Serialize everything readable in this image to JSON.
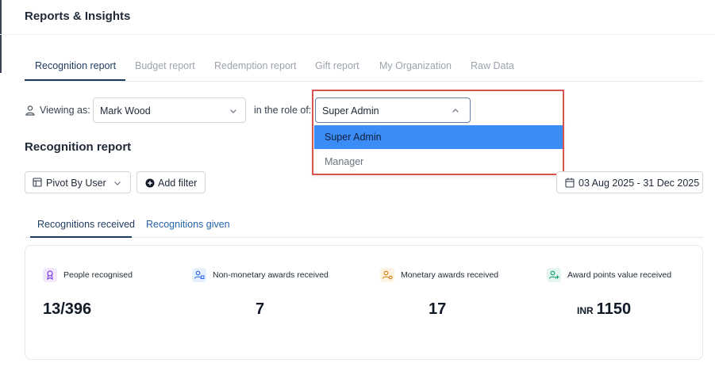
{
  "page": {
    "title": "Reports & Insights"
  },
  "tabs": [
    {
      "label": "Recognition report",
      "active": true
    },
    {
      "label": "Budget report",
      "active": false
    },
    {
      "label": "Redemption report",
      "active": false
    },
    {
      "label": "Gift report",
      "active": false
    },
    {
      "label": "My Organization",
      "active": false
    },
    {
      "label": "Raw Data",
      "active": false
    }
  ],
  "viewing": {
    "label": "Viewing as:",
    "user": "Mark Wood",
    "role_label": "in the role of:",
    "role": "Super Admin",
    "role_options": [
      "Super Admin",
      "Manager"
    ]
  },
  "report": {
    "title": "Recognition report",
    "pivot_label": "Pivot By User",
    "add_filter_label": "Add filter",
    "date_range": "03 Aug 2025 - 31 Dec 2025"
  },
  "sub_tabs": [
    {
      "label": "Recognitions received",
      "active": true
    },
    {
      "label": "Recognitions given",
      "active": false
    }
  ],
  "stats": [
    {
      "label": "People recognised",
      "value": "13/396",
      "prefix": ""
    },
    {
      "label": "Non-monetary awards received",
      "value": "7",
      "prefix": ""
    },
    {
      "label": "Monetary awards received",
      "value": "17",
      "prefix": ""
    },
    {
      "label": "Award points value received",
      "value": "1150",
      "prefix": "INR"
    }
  ],
  "colors": {
    "accent": "#1e3a5f",
    "selected_option": "#3b8cf5",
    "highlight": "#d9534f"
  }
}
